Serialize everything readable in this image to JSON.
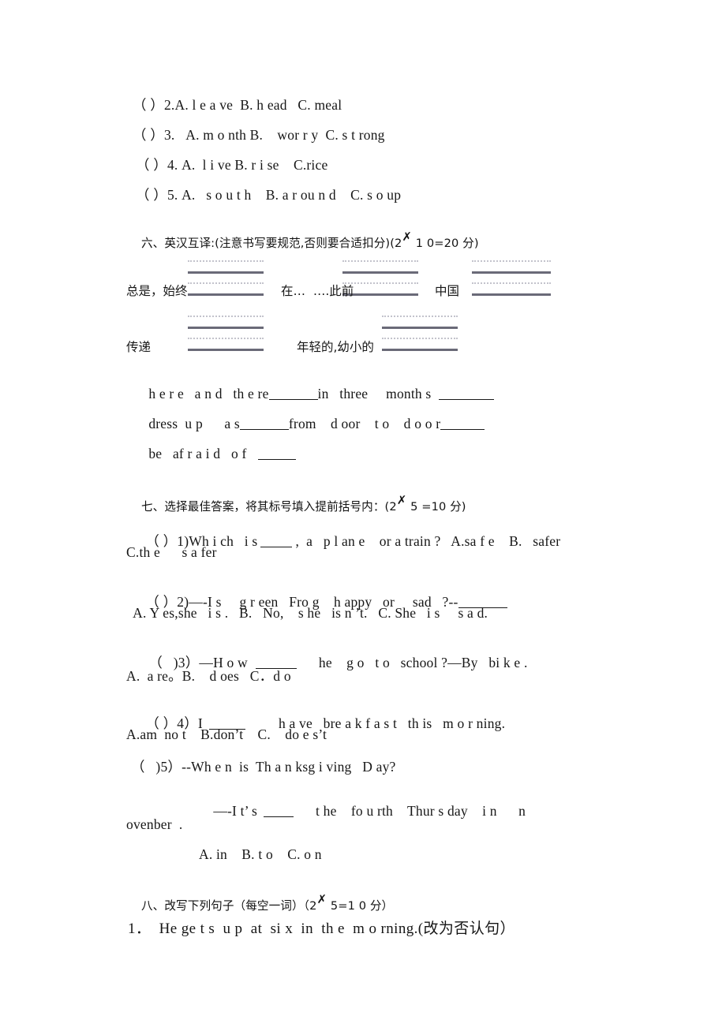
{
  "document": {
    "kind": "scanned-exam-paper",
    "language": "zh-CN/en",
    "page_background": "#ffffff",
    "ink_color": "#161616",
    "guide_line_dark": "#6a6a78",
    "guide_line_light": "#b9b9c4"
  },
  "listening_choices": {
    "items": [
      {
        "id": "q2",
        "text": "（ ）2.A. l e a ve  B. h ead   C. meal"
      },
      {
        "id": "q3",
        "text": "（ ）3.   A. m o nth B.    wor r y  C. s t rong"
      },
      {
        "id": "q4",
        "text": "（ ）4. A.  l i ve B. r i se    C.rice"
      },
      {
        "id": "q5",
        "text": "（ ）5. A.   s o u t h    B. a r ou n d    C. s o up"
      }
    ]
  },
  "section_six": {
    "heading_prefix": "六、英汉互译:(注意书写要规范,否则要合适扣分)(2",
    "heading_xmark": "✗",
    "heading_suffix": " 1 0=20 分)",
    "cn_terms_row1": [
      {
        "label": "总是，始终"
      },
      {
        "label": "在…  ….此前"
      },
      {
        "label": "中国"
      }
    ],
    "cn_terms_row2": [
      {
        "label": "传递"
      },
      {
        "label": "年轻的,幼小的"
      }
    ],
    "en_phrases": [
      {
        "id": "p1",
        "text": "h e r e   a n d   th e re"
      },
      {
        "id": "p2",
        "text": "in   three     month s"
      },
      {
        "id": "p3",
        "text": "dress  u p      a s"
      },
      {
        "id": "p4",
        "text": "from    d oor    t o    d o o r"
      },
      {
        "id": "p5",
        "text": "be   af r a i d   o f"
      }
    ]
  },
  "section_seven": {
    "heading_prefix": "七、选择最佳答案，将其标号填入提前括号内：(2",
    "heading_xmark": "✗",
    "heading_suffix": " 5 =10 分)",
    "questions": [
      {
        "id": "s7q1",
        "stem_a": "（ ）1)Wh i ch   i s",
        "stem_b": ",  a   p l an e    or a train ?   A.sa f e    B.   safer",
        "stem_c": "C.th e      s a fer"
      },
      {
        "id": "s7q2",
        "stem_a": "（ ）2)—-I s     g r een   Fro g    h appy   or     sad   ?--",
        "stem_b": "  A. Y es,she   i s .   B.   No,    s he   is n ’t.   C. She   i s     s a d."
      },
      {
        "id": "s7q3",
        "stem_a": "（   )3）—H o w",
        "stem_b": "he    g o   t o   school ?—By   bi k e .",
        "stem_c": "A.  a re。B.    d oes   C．d o"
      },
      {
        "id": "s7q4",
        "stem_a": "（ ）4）I",
        "stem_b": "h a ve   bre a k f a s t   th is   m o r ning.",
        "stem_c": "A.am  no t    B.don’t    C.    do e s’t"
      },
      {
        "id": "s7q5",
        "stem_a": "（   )5）--Wh e n  is  Th a n ksg i ving   D ay?",
        "stem_b": "—-I t’ s",
        "stem_b2": "t he    fo u rth    Thur s day    i n      n",
        "stem_c": "ovenber  .",
        "stem_d": "A. in    B. t o    C. o n"
      }
    ]
  },
  "section_eight": {
    "heading_prefix": "八、改写下列句子（每空一词）（2",
    "heading_xmark": "✗",
    "heading_suffix": " 5=1 0 分）",
    "items": [
      {
        "id": "s8q1",
        "text": "1．  He ge t s  u p  at  si x  in  th e  m o rning.(改为否认句）"
      }
    ]
  }
}
